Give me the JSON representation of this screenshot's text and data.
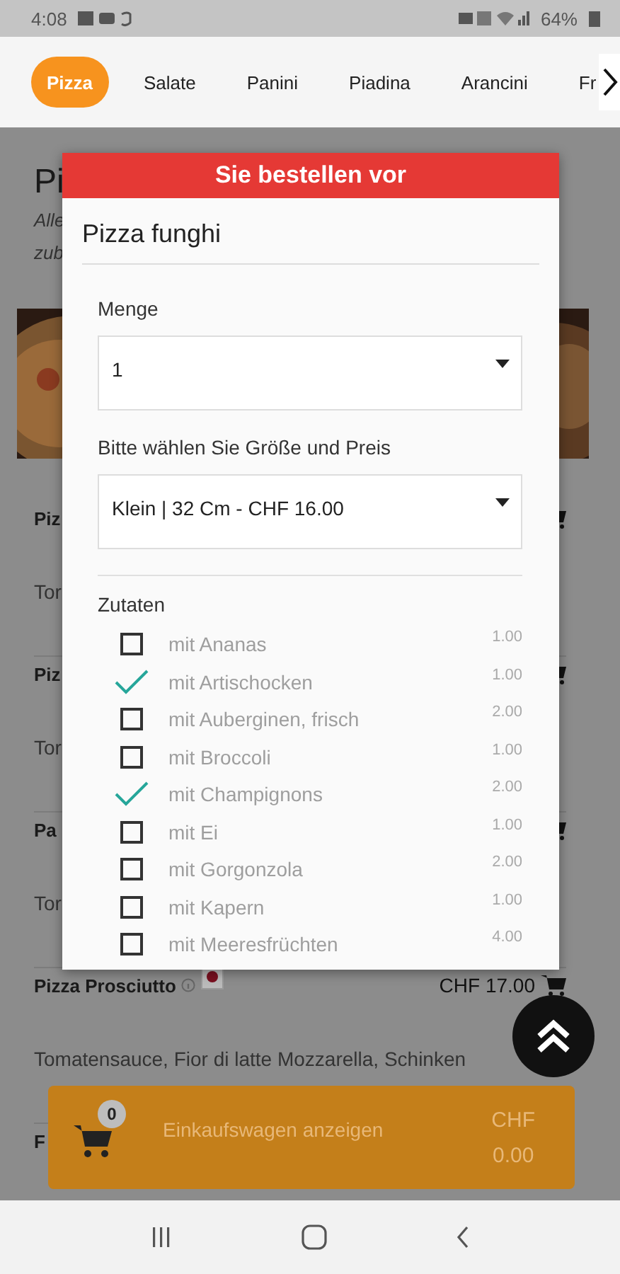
{
  "status_bar": {
    "time": "4:08",
    "battery": "64%"
  },
  "tabs": [
    {
      "label": "Pizza",
      "selected": true
    },
    {
      "label": "Salate",
      "selected": false
    },
    {
      "label": "Panini",
      "selected": false
    },
    {
      "label": "Piadina",
      "selected": false
    },
    {
      "label": "Arancini",
      "selected": false
    },
    {
      "label": "Fr",
      "selected": false
    }
  ],
  "page": {
    "title": "Pi",
    "description_lines": [
      "Alle",
      "zub"
    ],
    "items": [
      {
        "name": "Piz",
        "description": "Tor",
        "cart_icon": true
      },
      {
        "name": "Piz",
        "description": "Tor",
        "cart_icon": true
      },
      {
        "name": "Pa",
        "description": "Tor",
        "cart_icon": true
      },
      {
        "name": "Pizza Prosciutto",
        "price": "CHF 17.00",
        "description": "Tomatensauce, Fior di latte Mozzarella, Schinken",
        "cart_icon": true,
        "info_icon": true
      },
      {
        "name": "F",
        "cart_icon": false
      }
    ]
  },
  "dialog": {
    "header": "Sie bestellen vor",
    "title": "Pizza funghi",
    "quantity": {
      "label": "Menge",
      "value": "1"
    },
    "size": {
      "label": "Bitte wählen Sie Größe und Preis",
      "value": "Klein | 32 Cm - CHF 16.00"
    },
    "ingredients_label": "Zutaten",
    "ingredients": [
      {
        "label": "mit Ananas",
        "price": "1.00",
        "checked": false
      },
      {
        "label": "mit Artischocken",
        "price": "1.00",
        "checked": true
      },
      {
        "label": "mit Auberginen, frisch",
        "price": "2.00",
        "checked": false
      },
      {
        "label": "mit Broccoli",
        "price": "1.00",
        "checked": false
      },
      {
        "label": "mit Champignons",
        "price": "2.00",
        "checked": true
      },
      {
        "label": "mit Ei",
        "price": "1.00",
        "checked": false
      },
      {
        "label": "mit Gorgonzola",
        "price": "2.00",
        "checked": false
      },
      {
        "label": "mit Kapern",
        "price": "1.00",
        "checked": false
      },
      {
        "label": "mit Meeresfrüchten",
        "price": "4.00",
        "checked": false
      }
    ]
  },
  "cart": {
    "count": "0",
    "label": "Einkaufswagen anzeigen",
    "currency": "CHF",
    "total": "0.00"
  }
}
